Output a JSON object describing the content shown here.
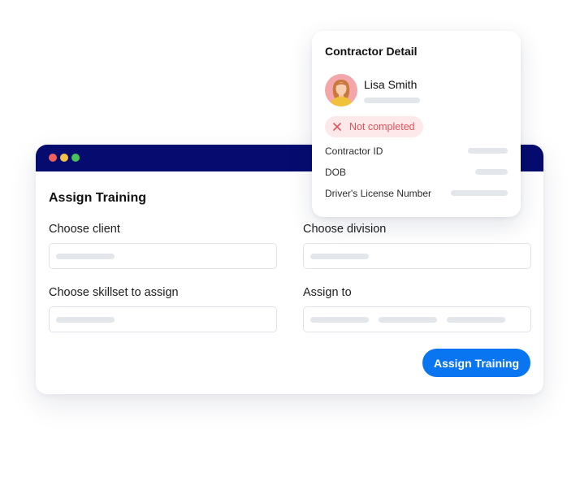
{
  "window": {
    "form_title": "Assign Training",
    "fields": {
      "client": {
        "label": "Choose client",
        "value": ""
      },
      "division": {
        "label": "Choose division",
        "value": ""
      },
      "skillset": {
        "label": "Choose skillset to assign",
        "value": ""
      },
      "assign_to": {
        "label": "Assign to",
        "value": ""
      }
    },
    "submit_label": "Assign Training"
  },
  "contractor_card": {
    "title": "Contractor Detail",
    "person": {
      "name": "Lisa Smith"
    },
    "status": {
      "label": "Not completed",
      "icon": "close-icon",
      "color": "#e2545a"
    },
    "details": [
      {
        "label": "Contractor ID"
      },
      {
        "label": "DOB"
      },
      {
        "label": "Driver's License Number"
      }
    ]
  },
  "colors": {
    "titlebar": "#060b6f",
    "accent": "#0a75f0",
    "status_bg": "#fde9ea",
    "placeholder_bar": "#e3e7ec"
  }
}
